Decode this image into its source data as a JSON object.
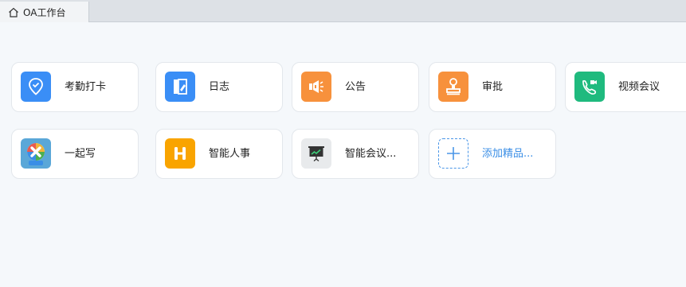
{
  "tab": {
    "title": "OA工作台",
    "icon": "home-icon"
  },
  "apps": [
    {
      "label": "考勤打卡",
      "icon": "location-check-icon",
      "color": "#3a8ef6"
    },
    {
      "label": "日志",
      "icon": "journal-edit-icon",
      "color": "#3a8ef6"
    },
    {
      "label": "公告",
      "icon": "megaphone-icon",
      "color": "#f7913c"
    },
    {
      "label": "审批",
      "icon": "stamp-icon",
      "color": "#f7913c"
    },
    {
      "label": "视频会议",
      "icon": "video-call-icon",
      "color": "#1fba7e"
    },
    {
      "label": "一起写",
      "icon": "collab-write-icon",
      "color": "#5aa7d8"
    },
    {
      "label": "智能人事",
      "icon": "hr-h-icon",
      "color": "#f9a400"
    },
    {
      "label": "智能会议...",
      "icon": "presentation-chart-icon",
      "color": "#e8eaec"
    },
    {
      "label": "添加精品...",
      "icon": "add-icon",
      "color": "#4a96e8"
    }
  ]
}
